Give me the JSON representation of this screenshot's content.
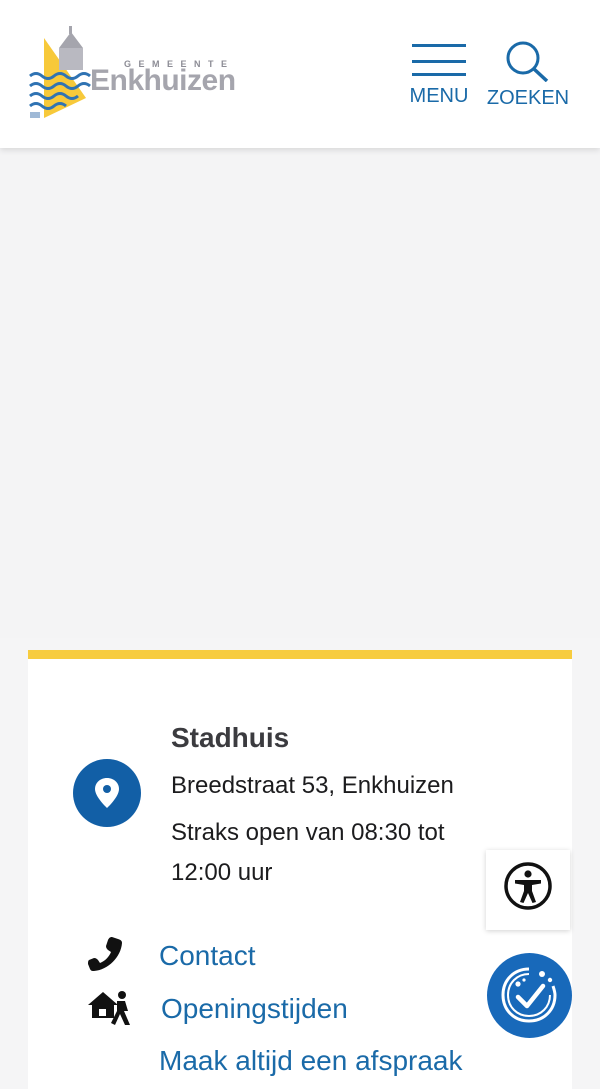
{
  "header": {
    "logo": {
      "small_text": "GEMEENTE",
      "name": "Enkhuizen"
    },
    "menu_label": "MENU",
    "search_label": "ZOEKEN"
  },
  "location": {
    "title": "Stadhuis",
    "address": "Breedstraat 53, Enkhuizen",
    "hours": "Straks open van 08:30 tot 12:00 uur"
  },
  "links": [
    {
      "label": "Contact",
      "icon": "phone-icon"
    },
    {
      "label": "Openingstijden",
      "icon": "house-walking-person-icon"
    },
    {
      "label": "Maak altijd een afspraak",
      "icon": ""
    }
  ],
  "floating": {
    "accessibility_icon": "accessibility-icon",
    "cookie_icon": "cookie-check-icon"
  },
  "colors": {
    "brand_blue": "#1a6aa8",
    "accent_yellow": "#f7cc3f",
    "pin_blue": "#125fa6",
    "cookie_blue": "#1869ba"
  }
}
